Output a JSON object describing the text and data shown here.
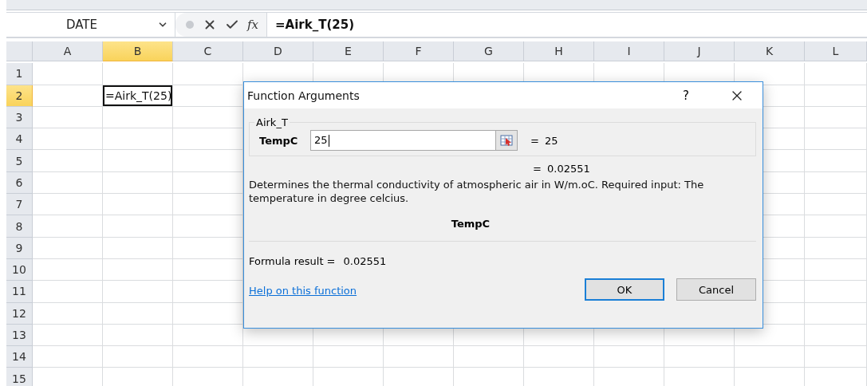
{
  "formula_bar": {
    "name_box": "DATE",
    "fx_label": "fx",
    "formula": "=Airk_T(25)"
  },
  "sheet": {
    "columns": [
      {
        "label": "A",
        "selected": false
      },
      {
        "label": "B",
        "selected": true
      },
      {
        "label": "C",
        "selected": false
      },
      {
        "label": "D",
        "selected": false
      },
      {
        "label": "E",
        "selected": false
      },
      {
        "label": "F",
        "selected": false
      },
      {
        "label": "G",
        "selected": false
      },
      {
        "label": "H",
        "selected": false
      },
      {
        "label": "I",
        "selected": false
      },
      {
        "label": "J",
        "selected": false
      },
      {
        "label": "K",
        "selected": false
      },
      {
        "label": "L",
        "selected": false
      }
    ],
    "rows": [
      {
        "label": "1",
        "selected": false
      },
      {
        "label": "2",
        "selected": true
      },
      {
        "label": "3",
        "selected": false
      },
      {
        "label": "4",
        "selected": false
      },
      {
        "label": "5",
        "selected": false
      },
      {
        "label": "6",
        "selected": false
      },
      {
        "label": "7",
        "selected": false
      },
      {
        "label": "8",
        "selected": false
      },
      {
        "label": "9",
        "selected": false
      },
      {
        "label": "10",
        "selected": false
      },
      {
        "label": "11",
        "selected": false
      },
      {
        "label": "12",
        "selected": false
      },
      {
        "label": "13",
        "selected": false
      },
      {
        "label": "14",
        "selected": false
      },
      {
        "label": "15",
        "selected": false
      }
    ],
    "active_cell": {
      "value": "=Airk_T(25)"
    }
  },
  "dialog": {
    "title": "Function Arguments",
    "help": "?",
    "function_name": "Airk_T",
    "arguments": [
      {
        "label": "TempC",
        "value": "25",
        "equals": "=",
        "evaluated": "25"
      }
    ],
    "result_equals": "=",
    "result": "0.02551",
    "description": "Determines the thermal conductivity of atmospheric air in W/m.oC. Required input: The temperature in degree celcius.",
    "argument_help_name": "TempC",
    "formula_result_label": "Formula result =",
    "formula_result": "0.02551",
    "help_link": "Help on this function",
    "buttons": [
      {
        "label": "OK",
        "default": true
      },
      {
        "label": "Cancel",
        "default": false
      }
    ]
  }
}
